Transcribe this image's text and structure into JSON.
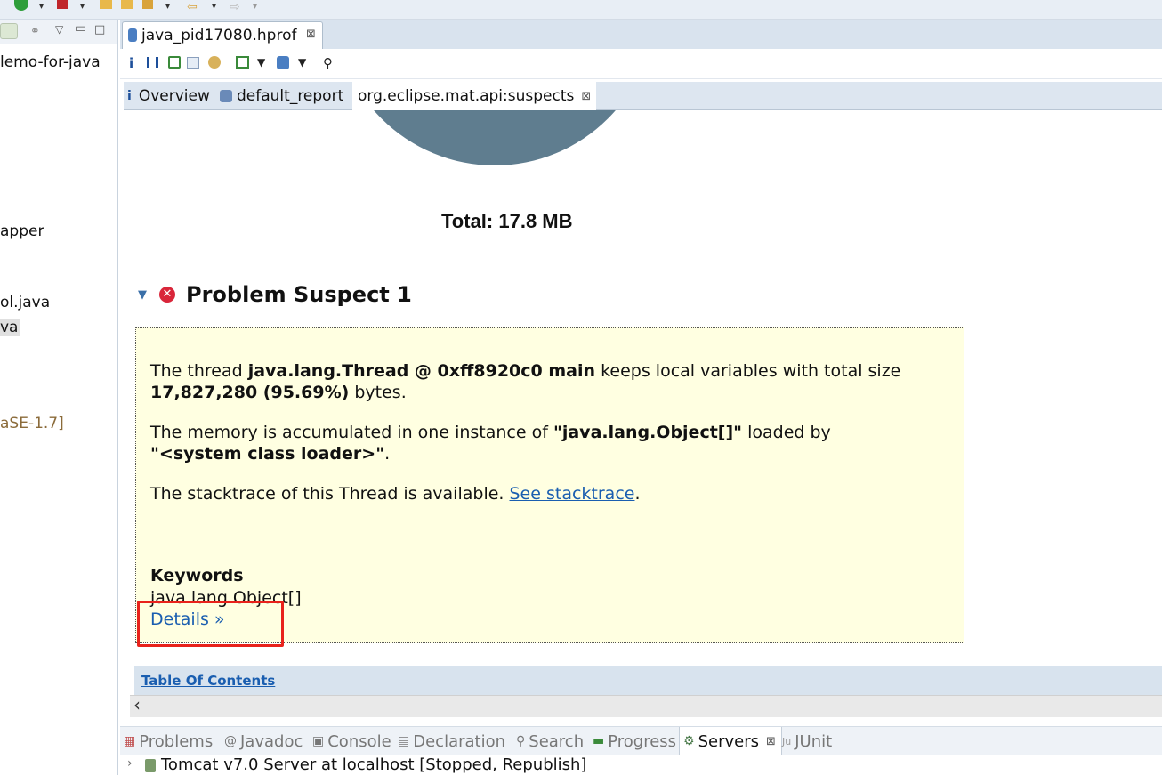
{
  "left_panel": {
    "items": [
      "lemo-for-java",
      "apper",
      "ol.java",
      "va",
      "aSE-1.7]"
    ]
  },
  "editor": {
    "tab_label": "java_pid17080.hprof",
    "close_glyph": "⊠"
  },
  "inner_tabs": {
    "overview": "Overview",
    "default_report": "default_report",
    "suspects": "org.eclipse.mat.api:suspects"
  },
  "report": {
    "total": "Total: 17.8 MB",
    "suspect_title": "Problem Suspect 1",
    "p1_a": "The thread ",
    "p1_b": "java.lang.Thread @ 0xff8920c0 main",
    "p1_c": " keeps local variables with total size",
    "p1_d": "17,827,280 (95.69%)",
    "p1_e": " bytes.",
    "p2_a": "The memory is accumulated in one instance of ",
    "p2_b": "\"java.lang.Object[]\"",
    "p2_c": " loaded by",
    "p2_d": "\"<system class loader>\"",
    "p2_e": ".",
    "p3_a": "The stacktrace of this Thread is available. ",
    "p3_link": "See stacktrace",
    "p3_end": ".",
    "keywords_label": "Keywords",
    "keywords_value": "java.lang.Object[]",
    "details_link": "Details »",
    "toc_link": "Table Of Contents"
  },
  "bottom_tabs": {
    "problems": "Problems",
    "javadoc": "Javadoc",
    "console": "Console",
    "declaration": "Declaration",
    "search": "Search",
    "progress": "Progress",
    "servers": "Servers",
    "junit": "JUnit"
  },
  "servers": {
    "row": "Tomcat v7.0 Server at localhost  [Stopped, Republish]"
  },
  "colors": {
    "pie": "#5f7d8f",
    "suspect_bg": "#ffffe1",
    "link": "#1a5eb0",
    "highlight": "#e8221b"
  }
}
